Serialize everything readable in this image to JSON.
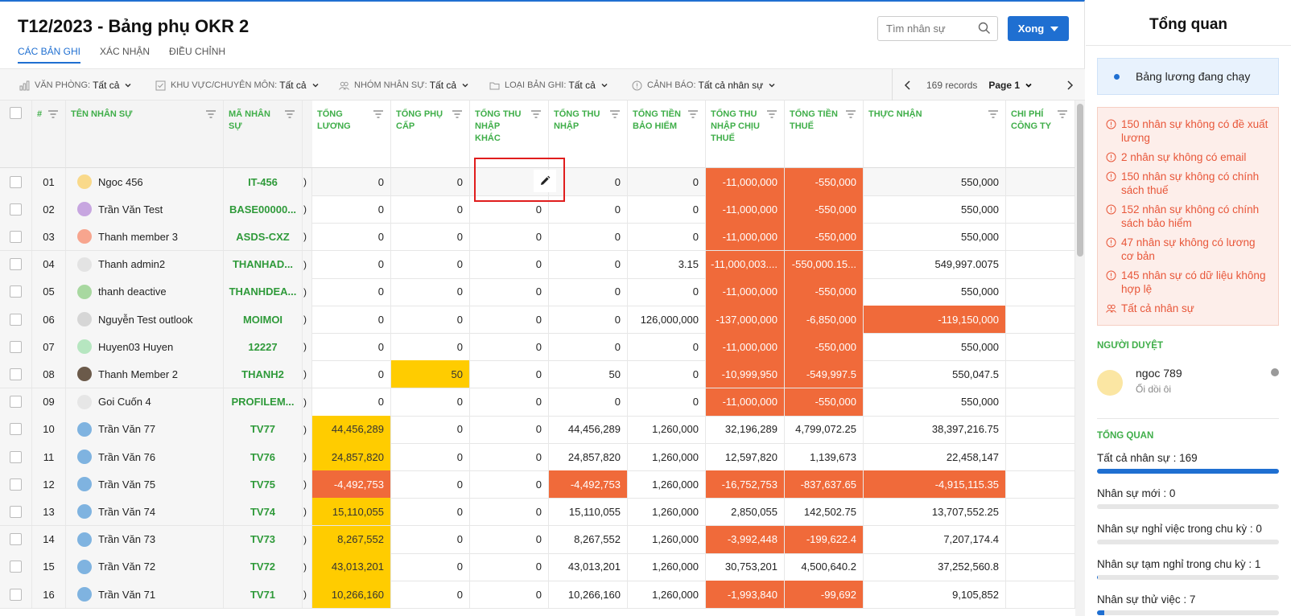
{
  "header": {
    "title": "T12/2023 - Bảng phụ OKR 2",
    "tabs": [
      "CÁC BẢN GHI",
      "XÁC NHẬN",
      "ĐIỀU CHỈNH"
    ],
    "search_placeholder": "Tìm nhân sự",
    "done_label": "Xong"
  },
  "filters": [
    {
      "label": "VĂN PHÒNG:",
      "value": "Tất cả",
      "icon": "chart-icon"
    },
    {
      "label": "KHU VỰC/CHUYÊN MÔN:",
      "value": "Tất cả",
      "icon": "checkbox-icon"
    },
    {
      "label": "NHÓM NHÂN SỰ:",
      "value": "Tất cả",
      "icon": "group-icon"
    },
    {
      "label": "LOẠI BẢN GHI:",
      "value": "Tất cả",
      "icon": "folder-icon"
    },
    {
      "label": "CẢNH BÁO:",
      "value": "Tất cả nhân sự",
      "icon": "alert-icon"
    }
  ],
  "pager": {
    "records": "169 records",
    "page": "Page 1"
  },
  "columns": [
    "#",
    "TÊN NHÂN SỰ",
    "MÃ NHÂN SỰ",
    "TỔNG LƯƠNG",
    "TỔNG PHỤ CẤP",
    "TỔNG THU NHẬP KHÁC",
    "TỔNG THU NHẬP",
    "TỔNG TIỀN BẢO HIỂM",
    "TỔNG THU NHẬP CHỊU THUẾ",
    "TỔNG TIỀN THUẾ",
    "THỰC NHẬN",
    "CHI PHÍ CÔNG TY"
  ],
  "rows": [
    {
      "idx": "01",
      "name": "Ngoc 456",
      "code": "IT-456",
      "avatar": "#f9d98a",
      "v": [
        "0",
        "0",
        "",
        "0",
        "0",
        "-11,000,000",
        "-550,000",
        "550,000"
      ]
    },
    {
      "idx": "02",
      "name": "Trần Văn Test",
      "code": "BASE00000...",
      "avatar": "#c7a6e0",
      "v": [
        "0",
        "0",
        "0",
        "0",
        "0",
        "-11,000,000",
        "-550,000",
        "550,000"
      ]
    },
    {
      "idx": "03",
      "name": "Thanh member 3",
      "code": "ASDS-CXZ",
      "avatar": "#f7a58e",
      "v": [
        "0",
        "0",
        "0",
        "0",
        "0",
        "-11,000,000",
        "-550,000",
        "550,000"
      ]
    },
    {
      "idx": "04",
      "name": "Thanh admin2",
      "code": "THANHAD...",
      "avatar": "#e3e3e3",
      "v": [
        "0",
        "0",
        "0",
        "0",
        "3.15",
        "-11,000,003....",
        "-550,000.15...",
        "549,997.0075"
      ]
    },
    {
      "idx": "05",
      "name": "thanh deactive",
      "code": "THANHDEA...",
      "avatar": "#a8d8a0",
      "v": [
        "0",
        "0",
        "0",
        "0",
        "0",
        "-11,000,000",
        "-550,000",
        "550,000"
      ]
    },
    {
      "idx": "06",
      "name": "Nguyễn Test outlook",
      "code": "MOIMOI",
      "avatar": "#d6d6d6",
      "v": [
        "0",
        "0",
        "0",
        "0",
        "126,000,000",
        "-137,000,000",
        "-6,850,000",
        "-119,150,000"
      ]
    },
    {
      "idx": "07",
      "name": "Huyen03 Huyen",
      "code": "12227",
      "avatar": "#b6e6c0",
      "v": [
        "0",
        "0",
        "0",
        "0",
        "0",
        "-11,000,000",
        "-550,000",
        "550,000"
      ]
    },
    {
      "idx": "08",
      "name": "Thanh Member 2",
      "code": "THANH2",
      "avatar": "#6b5a4a",
      "v": [
        "0",
        "50",
        "0",
        "50",
        "0",
        "-10,999,950",
        "-549,997.5",
        "550,047.5"
      ]
    },
    {
      "idx": "09",
      "name": "Goi Cuốn 4",
      "code": "PROFILEM...",
      "avatar": "#e6e6e6",
      "v": [
        "0",
        "0",
        "0",
        "0",
        "0",
        "-11,000,000",
        "-550,000",
        "550,000"
      ]
    },
    {
      "idx": "10",
      "name": "Trần Văn 77",
      "code": "TV77",
      "avatar": "#7fb3e0",
      "v": [
        "44,456,289",
        "0",
        "0",
        "44,456,289",
        "1,260,000",
        "32,196,289",
        "4,799,072.25",
        "38,397,216.75"
      ]
    },
    {
      "idx": "11",
      "name": "Trần Văn 76",
      "code": "TV76",
      "avatar": "#7fb3e0",
      "v": [
        "24,857,820",
        "0",
        "0",
        "24,857,820",
        "1,260,000",
        "12,597,820",
        "1,139,673",
        "22,458,147"
      ]
    },
    {
      "idx": "12",
      "name": "Trần Văn 75",
      "code": "TV75",
      "avatar": "#7fb3e0",
      "v": [
        "-4,492,753",
        "0",
        "0",
        "-4,492,753",
        "1,260,000",
        "-16,752,753",
        "-837,637.65",
        "-4,915,115.35"
      ]
    },
    {
      "idx": "13",
      "name": "Trần Văn 74",
      "code": "TV74",
      "avatar": "#7fb3e0",
      "v": [
        "15,110,055",
        "0",
        "0",
        "15,110,055",
        "1,260,000",
        "2,850,055",
        "142,502.75",
        "13,707,552.25"
      ]
    },
    {
      "idx": "14",
      "name": "Trần Văn 73",
      "code": "TV73",
      "avatar": "#7fb3e0",
      "v": [
        "8,267,552",
        "0",
        "0",
        "8,267,552",
        "1,260,000",
        "-3,992,448",
        "-199,622.4",
        "7,207,174.4"
      ]
    },
    {
      "idx": "15",
      "name": "Trần Văn 72",
      "code": "TV72",
      "avatar": "#7fb3e0",
      "v": [
        "43,013,201",
        "0",
        "0",
        "43,013,201",
        "1,260,000",
        "30,753,201",
        "4,500,640.2",
        "37,252,560.8"
      ]
    },
    {
      "idx": "16",
      "name": "Trần Văn 71",
      "code": "TV71",
      "avatar": "#7fb3e0",
      "v": [
        "10,266,160",
        "0",
        "0",
        "10,266,160",
        "1,260,000",
        "-1,993,840",
        "-99,692",
        "9,105,852"
      ]
    }
  ],
  "colors": {
    "accent": "#1f6fd1",
    "negative": "#f06a3a",
    "highlight": "#ffcc00",
    "header_green": "#3fae49"
  },
  "sidebar": {
    "title": "Tổng quan",
    "status": "Bảng lương đang chạy",
    "warnings": [
      "150 nhân sự không có đề xuất lương",
      "2 nhân sự không có email",
      "150 nhân sự không có chính sách thuế",
      "152 nhân sự không có chính sách bảo hiểm",
      "47 nhân sự không có lương cơ bản",
      "145 nhân sự có dữ liệu không hợp lệ"
    ],
    "all_staff": "Tất cả nhân sự",
    "approver_heading": "NGƯỜI DUYỆT",
    "approver_name": "ngoc 789",
    "approver_sub": "Ối dồi ôi",
    "overview_heading": "TỔNG QUAN",
    "stats": [
      {
        "label": "Tất cả nhân sự : 169",
        "fraction": 1.0
      },
      {
        "label": "Nhân sự mới : 0",
        "fraction": 0
      },
      {
        "label": "Nhân sự nghỉ việc trong chu kỳ : 0",
        "fraction": 0
      },
      {
        "label": "Nhân sự tạm nghỉ trong chu kỳ : 1",
        "fraction": 0.006
      },
      {
        "label": "Nhân sự thử việc : 7",
        "fraction": 0.04
      }
    ]
  }
}
